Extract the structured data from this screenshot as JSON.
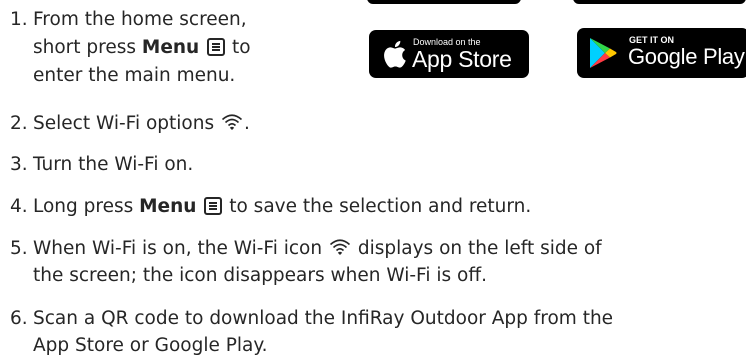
{
  "steps": [
    {
      "number": "1.",
      "line1": "From the home screen,",
      "line2_pre": "short press ",
      "line2_bold": "Menu",
      "line2_post": " to",
      "line3": "enter the main menu."
    },
    {
      "number": "2.",
      "pre": "Select Wi-Fi options ",
      "post": "."
    },
    {
      "number": "3.",
      "text": "Turn the Wi-Fi on."
    },
    {
      "number": "4.",
      "pre": "Long press ",
      "bold": "Menu",
      "post": " to save the selection and return."
    },
    {
      "number": "5.",
      "line1_pre": "When Wi-Fi is on, the Wi-Fi icon ",
      "line1_post": " displays on the left side of",
      "line2": "the screen; the icon disappears when Wi-Fi is off."
    },
    {
      "number": "6.",
      "line1": "Scan a QR code to download the InfiRay Outdoor App from the",
      "line2": "App Store or Google Play."
    }
  ],
  "badges": {
    "app_store": {
      "small": "Download on the",
      "big": "App Store"
    },
    "google_play": {
      "small": "GET IT ON",
      "big": "Google Play"
    }
  },
  "colors": {
    "text": "#262626",
    "badge_bg": "#000000",
    "badge_text": "#ffffff"
  },
  "icons": {
    "menu": "menu-icon",
    "wifi": "wifi-icon",
    "apple": "apple-icon",
    "play": "google-play-icon"
  }
}
